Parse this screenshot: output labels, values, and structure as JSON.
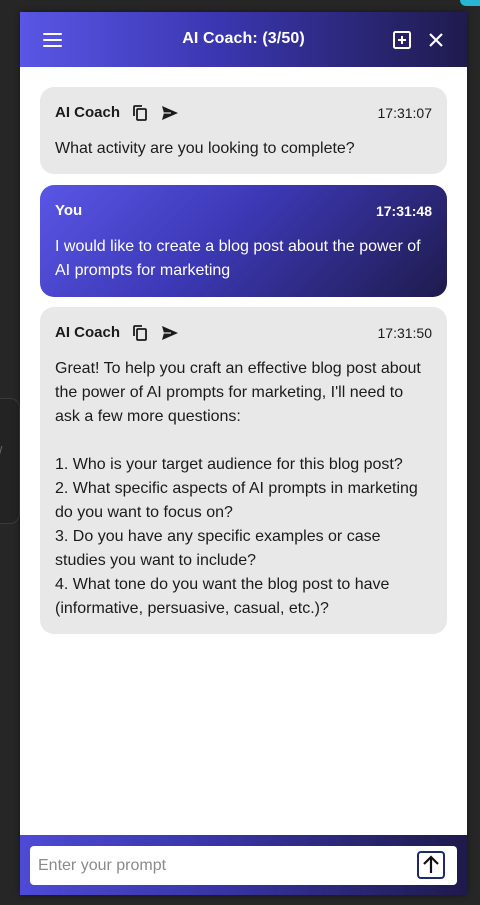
{
  "header": {
    "title": "AI Coach: (3/50)",
    "icons": {
      "menu": "hamburger-menu-icon",
      "new": "add-box-icon",
      "close": "close-icon"
    }
  },
  "messages": [
    {
      "role": "assistant",
      "sender": "AI Coach",
      "time": "17:31:07",
      "text": "What activity are you looking to complete?"
    },
    {
      "role": "user",
      "sender": "You",
      "time": "17:31:48",
      "text": "I would like to create a blog post about the power of AI prompts for marketing"
    },
    {
      "role": "assistant",
      "sender": "AI Coach",
      "time": "17:31:50",
      "text": "Great! To help you craft an effective blog post about the power of AI prompts for marketing, I'll need to ask a few more questions:\n\n1. Who is your target audience for this blog post?\n2. What specific aspects of AI prompts in marketing do you want to focus on?\n3. Do you have any specific examples or case studies you want to include?\n4. What tone do you want the blog post to have (informative, persuasive, casual, etc.)?"
    }
  ],
  "composer": {
    "placeholder": "Enter your prompt",
    "value": "",
    "send_icon": "arrow-up-icon"
  },
  "colors": {
    "accent_start": "#5a56e6",
    "accent_end": "#1f1b4d",
    "bot_bubble": "#e8e8e8",
    "background": "#262626"
  }
}
